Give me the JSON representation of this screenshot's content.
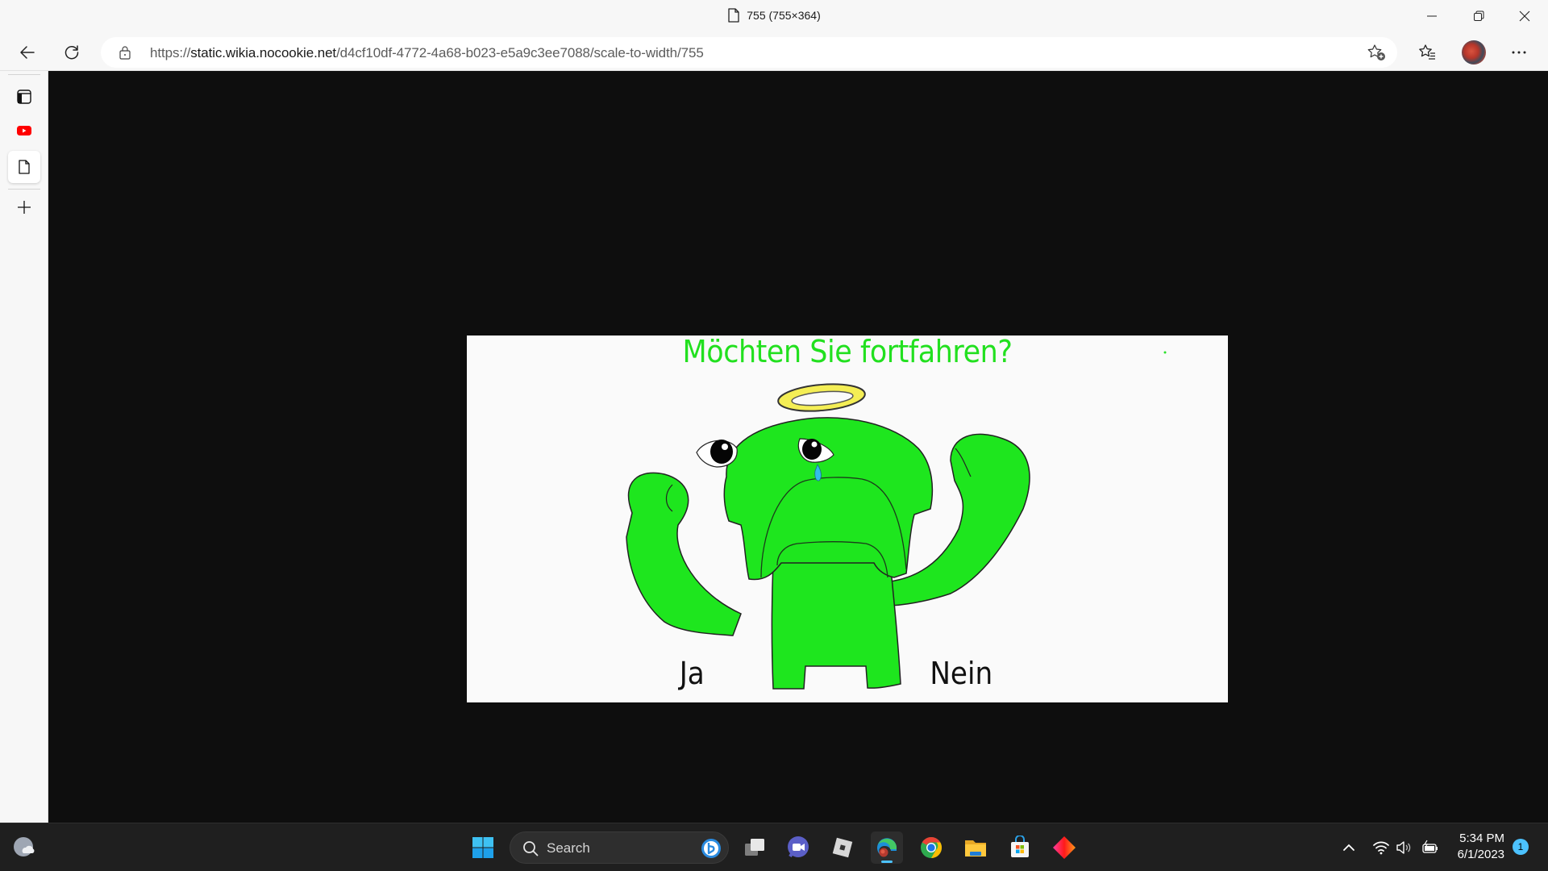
{
  "window": {
    "title": "755 (755×364)",
    "controls": {
      "minimize": "minimize",
      "restore": "restore",
      "close": "close"
    }
  },
  "toolbar": {
    "back_icon": "back-arrow-icon",
    "refresh_icon": "refresh-icon",
    "address": {
      "scheme": "https://",
      "host": "static.wikia.nocookie.net",
      "path": "/d4cf10df-4772-4a68-b023-e5a9c3ee7088/scale-to-width/755",
      "lock_icon": "lock-icon",
      "add_favorite_icon": "star-plus-icon"
    },
    "favorites_icon": "favorites-icon",
    "profile_icon": "profile-avatar",
    "more_icon": "more-dots-icon"
  },
  "sidebar": {
    "items": [
      {
        "name": "tab-actions",
        "icon": "tab-panel-icon"
      },
      {
        "name": "youtube-tab",
        "icon": "youtube-icon"
      },
      {
        "name": "current-image-tab",
        "icon": "document-icon",
        "active": true
      },
      {
        "name": "new-tab",
        "icon": "plus-icon"
      }
    ]
  },
  "image": {
    "natural_width": 755,
    "natural_height": 364,
    "caption_title": "Möchten Sie fortfahren?",
    "option_yes": "Ja",
    "option_no": "Nein",
    "colors": {
      "title": "#22e01f",
      "creature": "#1ee61e",
      "halo": "#f4ee55",
      "tear": "#33bde8",
      "background": "#fafafa"
    }
  },
  "taskbar": {
    "weather_icon": "weather-moon-cloud-icon",
    "start_icon": "windows-start-icon",
    "search": {
      "placeholder": "Search",
      "bing_icon": "bing-icon"
    },
    "apps": [
      {
        "name": "task-view",
        "icon": "task-view-icon"
      },
      {
        "name": "teams-meet",
        "icon": "video-chat-icon"
      },
      {
        "name": "roblox",
        "icon": "roblox-icon"
      },
      {
        "name": "edge",
        "icon": "edge-icon",
        "active": true
      },
      {
        "name": "chrome",
        "icon": "chrome-icon"
      },
      {
        "name": "file-explorer",
        "icon": "folder-icon"
      },
      {
        "name": "microsoft-store",
        "icon": "store-icon"
      },
      {
        "name": "app-diamond",
        "icon": "diamond-icon"
      }
    ],
    "tray": {
      "overflow_icon": "chevron-up-icon",
      "wifi_icon": "wifi-icon",
      "volume_icon": "volume-icon",
      "battery_icon": "battery-charging-icon",
      "time": "5:34 PM",
      "date": "6/1/2023",
      "notification_count": "1"
    }
  }
}
